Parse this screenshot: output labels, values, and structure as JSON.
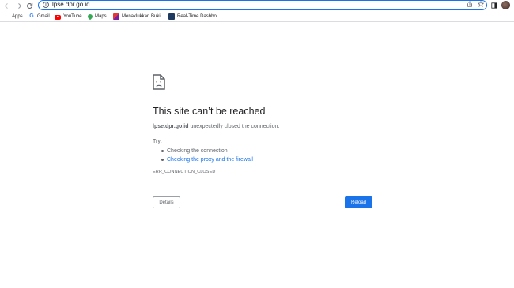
{
  "toolbar": {
    "back_icon": "arrow-left-icon",
    "forward_icon": "arrow-right-icon",
    "reload_icon": "reload-icon",
    "url": "lpse.dpr.go.id",
    "share_icon": "share-icon",
    "bookmark_star_icon": "star-icon",
    "sidepanel_icon": "side-panel-icon"
  },
  "bookmarks": [
    {
      "label": "Apps",
      "icon": "apps-grid-icon"
    },
    {
      "label": "Gmail",
      "icon": "google-icon"
    },
    {
      "label": "YouTube",
      "icon": "youtube-icon"
    },
    {
      "label": "Maps",
      "icon": "maps-pin-icon"
    },
    {
      "label": "Menaklukkan Buki...",
      "icon": "bookmark-favicon"
    },
    {
      "label": "Real-Time Dashbo...",
      "icon": "dashboard-favicon"
    }
  ],
  "error": {
    "title": "This site can’t be reached",
    "host": "lpse.dpr.go.id",
    "description_rest": " unexpectedly closed the connection.",
    "try_label": "Try:",
    "suggestions": [
      "Checking the connection",
      "Checking the proxy and the firewall"
    ],
    "code": "ERR_CONNECTION_CLOSED",
    "details_label": "Details",
    "reload_label": "Reload"
  },
  "colors": {
    "accent": "#1a73e8",
    "text": "#202124",
    "muted": "#5f6368"
  }
}
